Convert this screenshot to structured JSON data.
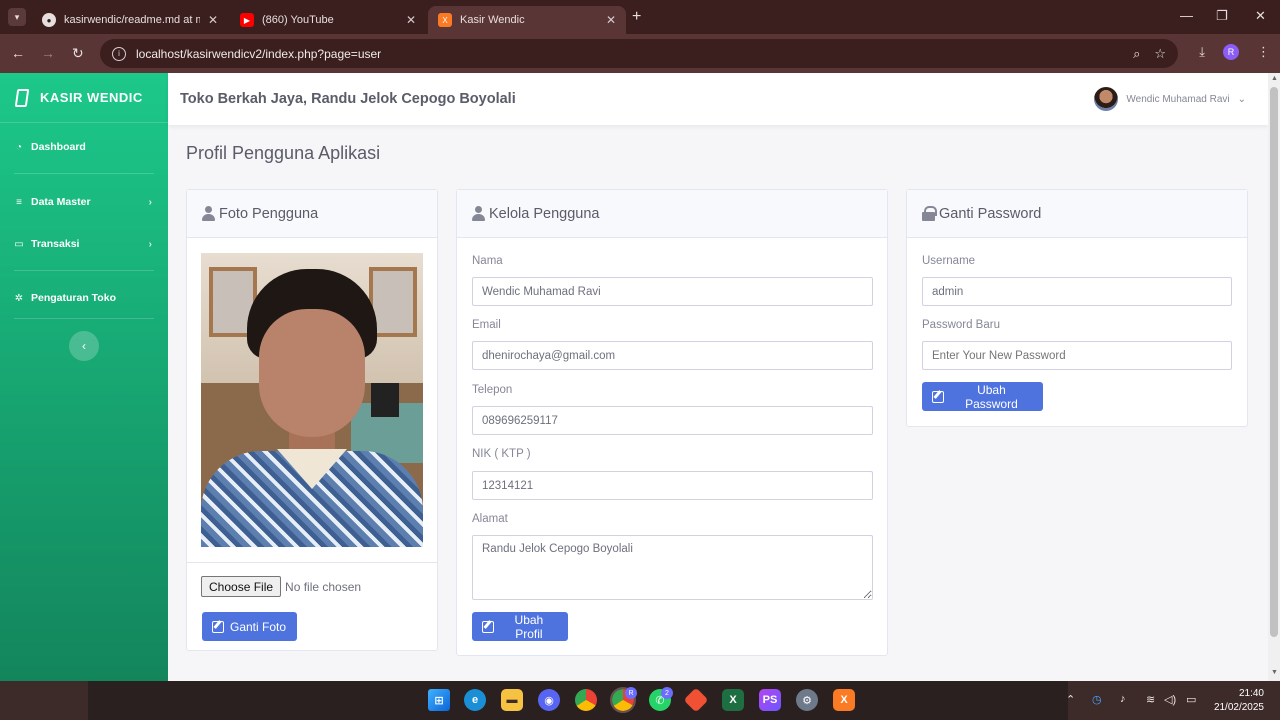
{
  "browser": {
    "tabs": [
      {
        "title": "kasirwendic/readme.md at mai",
        "icon": "github-icon"
      },
      {
        "title": "(860) YouTube",
        "icon": "youtube-icon"
      },
      {
        "title": "Kasir Wendic",
        "icon": "xampp-icon",
        "active": true
      }
    ],
    "url": "localhost/kasirwendicv2/index.php?page=user",
    "profile_initial": "R"
  },
  "sidebar": {
    "brand": "KASIR WENDIC",
    "items": [
      {
        "label": "Dashboard",
        "icon": "dashboard-icon"
      },
      {
        "label": "Data Master",
        "icon": "database-icon"
      },
      {
        "label": "Transaksi",
        "icon": "desktop-icon"
      },
      {
        "label": "Pengaturan Toko",
        "icon": "cogs-icon"
      }
    ],
    "toggle_symbol": "‹"
  },
  "topbar": {
    "store_name": "Toko Berkah Jaya, Randu Jelok Cepogo Boyolali",
    "user_name": "Wendic Muhamad Ravi"
  },
  "page": {
    "title": "Profil Pengguna Aplikasi"
  },
  "photo_card": {
    "header": "Foto Pengguna",
    "choose_file": "Choose File",
    "no_file": "No file chosen",
    "button": "Ganti Foto"
  },
  "manage_card": {
    "header": "Kelola Pengguna",
    "fields": {
      "nama_label": "Nama",
      "nama_value": "Wendic Muhamad Ravi",
      "email_label": "Email",
      "email_value": "dhenirochaya@gmail.com",
      "telepon_label": "Telepon",
      "telepon_value": "089696259117",
      "nik_label": "NIK ( KTP )",
      "nik_value": "12314121",
      "alamat_label": "Alamat",
      "alamat_value": "Randu Jelok Cepogo Boyolali"
    },
    "button": "Ubah Profil"
  },
  "password_card": {
    "header": "Ganti Password",
    "username_label": "Username",
    "username_value": "admin",
    "password_label": "Password Baru",
    "password_placeholder": "Enter Your New Password",
    "button": "Ubah Password"
  },
  "taskbar": {
    "time": "21:40",
    "date": "21/02/2025",
    "whatsapp_badge": "2",
    "chrome_badge": "R"
  },
  "colors": {
    "sidebar_top": "#1cc88a",
    "sidebar_bottom": "#13855c",
    "primary_button": "#4e73df",
    "browser_frame": "#5a3535"
  }
}
